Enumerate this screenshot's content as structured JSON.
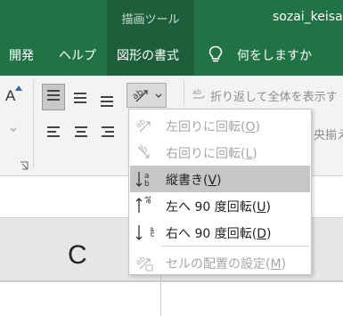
{
  "title_bar": {
    "contextual_tab_group": "描画ツール",
    "filename": "sozai_keisa"
  },
  "tabs": [
    {
      "label": "開発"
    },
    {
      "label": "ヘルプ"
    },
    {
      "label": "図形の書式"
    }
  ],
  "tell_me": {
    "label": "何をしますか",
    "icon": "lightbulb-icon"
  },
  "ribbon": {
    "font_glyph": "A",
    "wrap_text": "折り返して全体を表示す",
    "merge_center": "央揃え",
    "orientation_icon": "ab-diagonal-icon",
    "dialog_launcher_icon": "dialog-launcher-icon"
  },
  "orientation_menu": {
    "items": [
      {
        "label": "左回りに回転",
        "accel": "O",
        "icon": "rotate-ccw-text-icon",
        "enabled": false,
        "highlighted": false
      },
      {
        "label": "右回りに回転",
        "accel": "L",
        "icon": "rotate-cw-text-icon",
        "enabled": false,
        "highlighted": false
      },
      {
        "label": "縦書き",
        "accel": "V",
        "icon": "vertical-text-icon",
        "enabled": true,
        "highlighted": true
      },
      {
        "label": "左へ 90 度回転",
        "accel": "U",
        "icon": "rotate-up-text-icon",
        "enabled": true,
        "highlighted": false
      },
      {
        "label": "右へ 90 度回転",
        "accel": "D",
        "icon": "rotate-down-text-icon",
        "enabled": true,
        "highlighted": false
      },
      {
        "label": "セルの配置の設定",
        "accel": "M",
        "icon": "format-cell-alignment-icon",
        "enabled": false,
        "highlighted": false
      }
    ]
  },
  "sheet": {
    "column_header": "C"
  },
  "colors": {
    "excel_green": "#217346",
    "contextual_green": "#1c5f3a",
    "menu_highlight": "#c6c6c6",
    "disabled_text": "#a6a6a6"
  }
}
